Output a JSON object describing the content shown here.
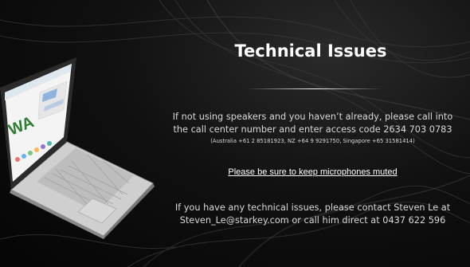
{
  "slide": {
    "title": "Technical Issues",
    "paragraph1_line1": "If not using speakers and you haven’t already, please call into",
    "paragraph1_line2": "the call center number and enter access code 2634 703 0783",
    "dial_in_numbers": "(Australia +61 2 85181923, NZ +64 9 9291750, Singapore +65 31581414)",
    "mute_notice": "Please be sure to keep microphones muted",
    "paragraph2_line1": "If you have any technical issues, please contact Steven Le at",
    "paragraph2_line2": "Steven_Le@starkey.com or call him direct at 0437 622 596",
    "laptop_logo_text": "WA"
  },
  "colors": {
    "background": "#0a0a0a",
    "text_primary": "#ffffff",
    "text_secondary": "#d9d9d9",
    "laptop_silver": "#c8c8c8"
  }
}
